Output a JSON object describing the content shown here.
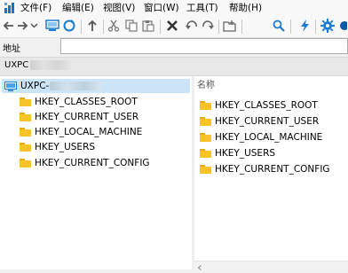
{
  "menu": [
    "文件(F)",
    "编辑(E)",
    "视图(V)",
    "窗口(W)",
    "工具(T)",
    "帮助(H)"
  ],
  "toolbar": {
    "icons": [
      "back-arrow-icon",
      "forward-arrow-icon",
      "dropdown-icon",
      "computer-icon",
      "refresh-icon",
      "up-arrow-icon",
      "cut-icon",
      "copy-icon",
      "paste-icon",
      "delete-icon",
      "undo-icon",
      "redo-icon",
      "new-folder-icon",
      "search-icon",
      "connect-icon",
      "settings-icon"
    ]
  },
  "address": {
    "label": "地址",
    "value": ""
  },
  "computer_tab": {
    "label": "UXPC"
  },
  "tree": {
    "root_label": "UXPC-",
    "items": [
      "HKEY_CLASSES_ROOT",
      "HKEY_CURRENT_USER",
      "HKEY_LOCAL_MACHINE",
      "HKEY_USERS",
      "HKEY_CURRENT_CONFIG"
    ]
  },
  "list": {
    "column_header": "名称",
    "items": [
      "HKEY_CLASSES_ROOT",
      "HKEY_CURRENT_USER",
      "HKEY_LOCAL_MACHINE",
      "HKEY_USERS",
      "HKEY_CURRENT_CONFIG"
    ]
  },
  "colors": {
    "selection": "#cce4f7",
    "folder": "#f8c229",
    "accent": "#0078d7"
  }
}
